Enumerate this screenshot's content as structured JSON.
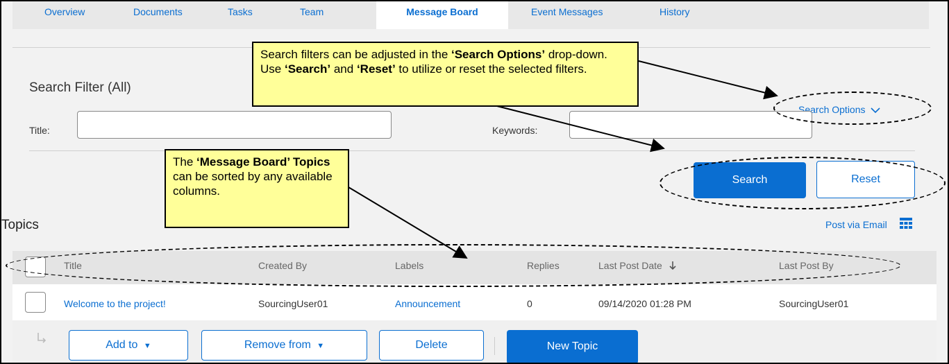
{
  "tabs": {
    "overview": "Overview",
    "documents": "Documents",
    "tasks": "Tasks",
    "team": "Team",
    "message_board": "Message Board",
    "event_messages": "Event Messages",
    "history": "History"
  },
  "search": {
    "title": "Search Filter (All)",
    "options_label": "Search Options",
    "title_label": "Title:",
    "keywords_label": "Keywords:",
    "title_value": "",
    "keywords_value": "",
    "search_button": "Search",
    "reset_button": "Reset"
  },
  "topics": {
    "heading": "Topics",
    "post_via_email": "Post via Email",
    "columns": {
      "title": "Title",
      "created_by": "Created By",
      "labels": "Labels",
      "replies": "Replies",
      "last_post_date": "Last Post Date",
      "last_post_by": "Last Post By"
    },
    "rows": [
      {
        "title": "Welcome to the project!",
        "created_by": "SourcingUser01",
        "labels": "Announcement",
        "replies": "0",
        "last_post_date": "09/14/2020 01:28 PM",
        "last_post_by": "SourcingUser01"
      }
    ]
  },
  "actions": {
    "add_to": "Add to",
    "remove_from": "Remove from",
    "delete": "Delete",
    "new_topic": "New Topic"
  },
  "callouts": {
    "search": {
      "p1": "Search filters can be adjusted in the ",
      "b1": "‘Search Options’",
      "p2": " drop-down. Use ",
      "b2": "‘Search’",
      "p3": " and ",
      "b3": "‘Reset’",
      "p4": " to utilize or reset the selected filters."
    },
    "topics": {
      "p1": "The ",
      "b1": "‘Message Board’ Topics",
      "p2": " can be sorted by any available columns."
    }
  },
  "colors": {
    "accent": "#0a6ed1",
    "callout": "#ffff99"
  }
}
